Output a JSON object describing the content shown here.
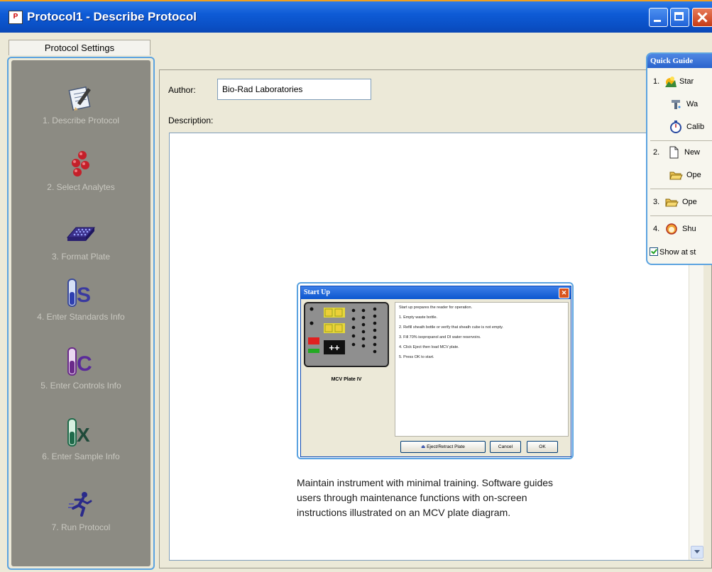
{
  "window": {
    "title": "Protocol1 - Describe Protocol",
    "icon_text": "P"
  },
  "settings_tab": "Protocol Settings",
  "steps": [
    {
      "label": "1. Describe Protocol",
      "icon": "notepad-pen-icon"
    },
    {
      "label": "2. Select Analytes",
      "icon": "red-beads-icon"
    },
    {
      "label": "3. Format Plate",
      "icon": "plate-grid-icon"
    },
    {
      "label": "4. Enter Standards Info",
      "icon": "tube-s-icon",
      "letter": "S"
    },
    {
      "label": "5. Enter Controls Info",
      "icon": "tube-c-icon",
      "letter": "C"
    },
    {
      "label": "6. Enter Sample Info",
      "icon": "tube-x-icon",
      "letter": "X"
    },
    {
      "label": "7. Run Protocol",
      "icon": "runner-icon"
    }
  ],
  "form": {
    "author_label": "Author:",
    "author_value": "Bio-Rad Laboratories",
    "description_label": "Description:"
  },
  "quick_guide": {
    "title": "Quick Guide",
    "rows": [
      {
        "num": "1.",
        "text": "Star",
        "icon": "startup-icon"
      },
      {
        "num": "",
        "text": "Wa",
        "icon": "wash-faucet-icon"
      },
      {
        "num": "",
        "text": "Calib",
        "icon": "calibrate-clock-icon"
      },
      {
        "num": "2.",
        "text": "New",
        "icon": "new-document-icon"
      },
      {
        "num": "",
        "text": "Ope",
        "icon": "open-folder-icon"
      },
      {
        "num": "3.",
        "text": "Ope",
        "icon": "open-folder-icon"
      },
      {
        "num": "4.",
        "text": "Shu",
        "icon": "shutdown-icon"
      }
    ],
    "show_at_start": "Show at st"
  },
  "startup_dialog": {
    "title": "Start Up",
    "plate_label": "MCV Plate IV",
    "lines": [
      "Start up prepares the reader for operation.",
      "1. Empty waste bottle.",
      "2. Refill sheath bottle or verify that sheath cube is not empty.",
      "3. Fill 70% isopropanol and DI water reservoirs.",
      "4. Click Eject then load MCV plate.",
      "5. Press OK to start."
    ],
    "buttons": {
      "eject": "Eject/Retract Plate",
      "cancel": "Cancel",
      "ok": "OK"
    }
  },
  "caption": "Maintain instrument with minimal training. Software guides users through maintenance functions with on-screen instructions illustrated on an MCV plate diagram.",
  "colors": {
    "titlebar": "#0e5bd6",
    "sidebar": "#8c8b83",
    "highlight_border": "#5ba3e0"
  }
}
